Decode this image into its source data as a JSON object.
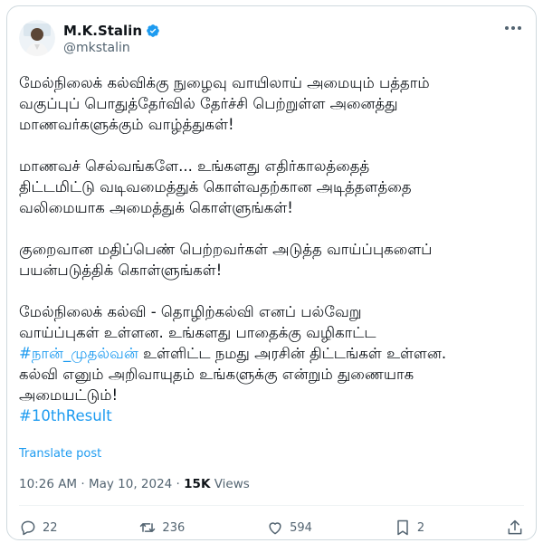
{
  "author": {
    "name": "M.K.Stalin",
    "handle": "@mkstalin"
  },
  "post": {
    "paragraphs": [
      "மேல்நிலைக் கல்விக்கு நுழைவு வாயிலாய் அமையும் பத்தாம்\nவகுப்புப் பொதுத்தேர்வில் தேர்ச்சி பெற்றுள்ள அனைத்து\nமாணவர்களுக்கும் வாழ்த்துகள்!",
      "மாணவச் செல்வங்களே... உங்களது எதிர்காலத்தைத்\nதிட்டமிட்டு வடிவமைத்துக் கொள்வதற்கான அடித்தளத்தை\nவலிமையாக அமைத்துக் கொள்ளுங்கள்!",
      "குறைவான மதிப்பெண் பெற்றவர்கள் அடுத்த வாய்ப்புகளைப்\nபயன்படுத்திக் கொள்ளுங்கள்!",
      "மேல்நிலைக் கல்வி - தொழிற்கல்வி எனப் பல்வேறு\nவாய்ப்புகள் உள்ளன. உங்களது பாதைக்கு வழிகாட்ட"
    ],
    "p4_hashtag": "#நான்_முதல்வன்",
    "p4_rest": " உள்ளிட்ட நமது அரசின் திட்டங்கள் உள்ளன.\nகல்வி எனும் அறிவாயுதம் உங்களுக்கு என்றும் துணையாக\nஅமையட்டும்!",
    "hashtag_line": "#10thResult",
    "translate_label": "Translate post",
    "timestamp": "10:26 AM · May 10, 2024 · ",
    "views_count": "15K",
    "views_label": " Views"
  },
  "actions": {
    "replies": "22",
    "reposts": "236",
    "likes": "594",
    "bookmarks": "2"
  },
  "colors": {
    "accent": "#1d9bf0",
    "muted": "#536471",
    "text": "#0f1419"
  }
}
